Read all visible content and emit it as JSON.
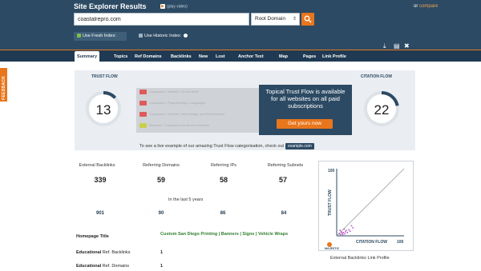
{
  "header": {
    "title": "Site Explorer Results",
    "play_video": "(play video)",
    "or_text": "or",
    "compare": "compare",
    "url_value": "coastalrepro.com",
    "domain_select": "Root Domain",
    "fresh_index": "Use Fresh Index:",
    "historic_index": "Use Historic Index:",
    "accent": "#e8761d",
    "brand": "#2c4a63"
  },
  "nav": [
    "Summary",
    "Topics",
    "Ref Domains",
    "Backlinks",
    "New",
    "Lost",
    "Anchor Text",
    "Map",
    "Pages",
    "Link Profile"
  ],
  "feedback": "FEEDBACK",
  "trust_flow": {
    "tf_label": "TRUST FLOW",
    "tf_value": "13",
    "tf_fraction": 0.13,
    "cf_label": "CITATION FLOW",
    "cf_value": "22",
    "cf_fraction": 0.22,
    "categories": [
      {
        "value": "6",
        "label": "Computers / Internet / On the Web",
        "color": "#e0595a"
      },
      {
        "value": "6",
        "label": "Computers / Programming / Languages",
        "color": "#e0595a"
      },
      {
        "value": "6",
        "label": "Computers / Internet / Web Design and Development",
        "color": "#e0595a"
      },
      {
        "value": "6",
        "label": "Business / Consumer Goods and Services",
        "color": "#c9cf4a"
      }
    ],
    "promo_text": "Topical Trust Flow is available for all websites on all paid subscriptions",
    "promo_button": "Get yours now",
    "footer_text": "To see a live example of our amazing Trust Flow categorisation, check out",
    "example_link": "example.com"
  },
  "stats": [
    {
      "label": "External Backlinks",
      "value": "339",
      "last5": "901"
    },
    {
      "label": "Referring Domains",
      "value": "59",
      "last5": "90"
    },
    {
      "label": "Referring IPs",
      "value": "58",
      "last5": "86"
    },
    {
      "label": "Referring Subnets",
      "value": "57",
      "last5": "84"
    }
  ],
  "last5_label": "In the last 5 years",
  "homepage": {
    "label": "Homepage Title",
    "title": "Custom San Diego Printing | Banners | Signs | Vehicle Wraps"
  },
  "edu_rows": [
    {
      "label": "Educational",
      "sub": "Ref. Backlinks",
      "value": "1"
    },
    {
      "label": "Educational",
      "sub": "Ref. Domains",
      "value": "1"
    }
  ],
  "link_profile": {
    "caption": "External Backlinks Link Profile",
    "y_label": "TRUST FLOW",
    "x_label": "CITATION FLOW",
    "y_max": "100",
    "x_max": "100",
    "logo": "MAJESTIC"
  },
  "chart_data": {
    "type": "scatter",
    "title": "External Backlinks Link Profile",
    "xlabel": "CITATION FLOW",
    "ylabel": "TRUST FLOW",
    "xlim": [
      0,
      100
    ],
    "ylim": [
      0,
      100
    ],
    "points": [
      {
        "x": 4,
        "y": 3
      },
      {
        "x": 6,
        "y": 2
      },
      {
        "x": 8,
        "y": 4
      },
      {
        "x": 10,
        "y": 5
      },
      {
        "x": 12,
        "y": 3
      },
      {
        "x": 7,
        "y": 6
      },
      {
        "x": 14,
        "y": 8
      },
      {
        "x": 16,
        "y": 5
      },
      {
        "x": 18,
        "y": 9
      },
      {
        "x": 5,
        "y": 8
      },
      {
        "x": 20,
        "y": 7
      },
      {
        "x": 11,
        "y": 10
      },
      {
        "x": 24,
        "y": 12
      },
      {
        "x": 9,
        "y": 2
      },
      {
        "x": 22,
        "y": 15
      },
      {
        "x": 13,
        "y": 6
      }
    ]
  }
}
